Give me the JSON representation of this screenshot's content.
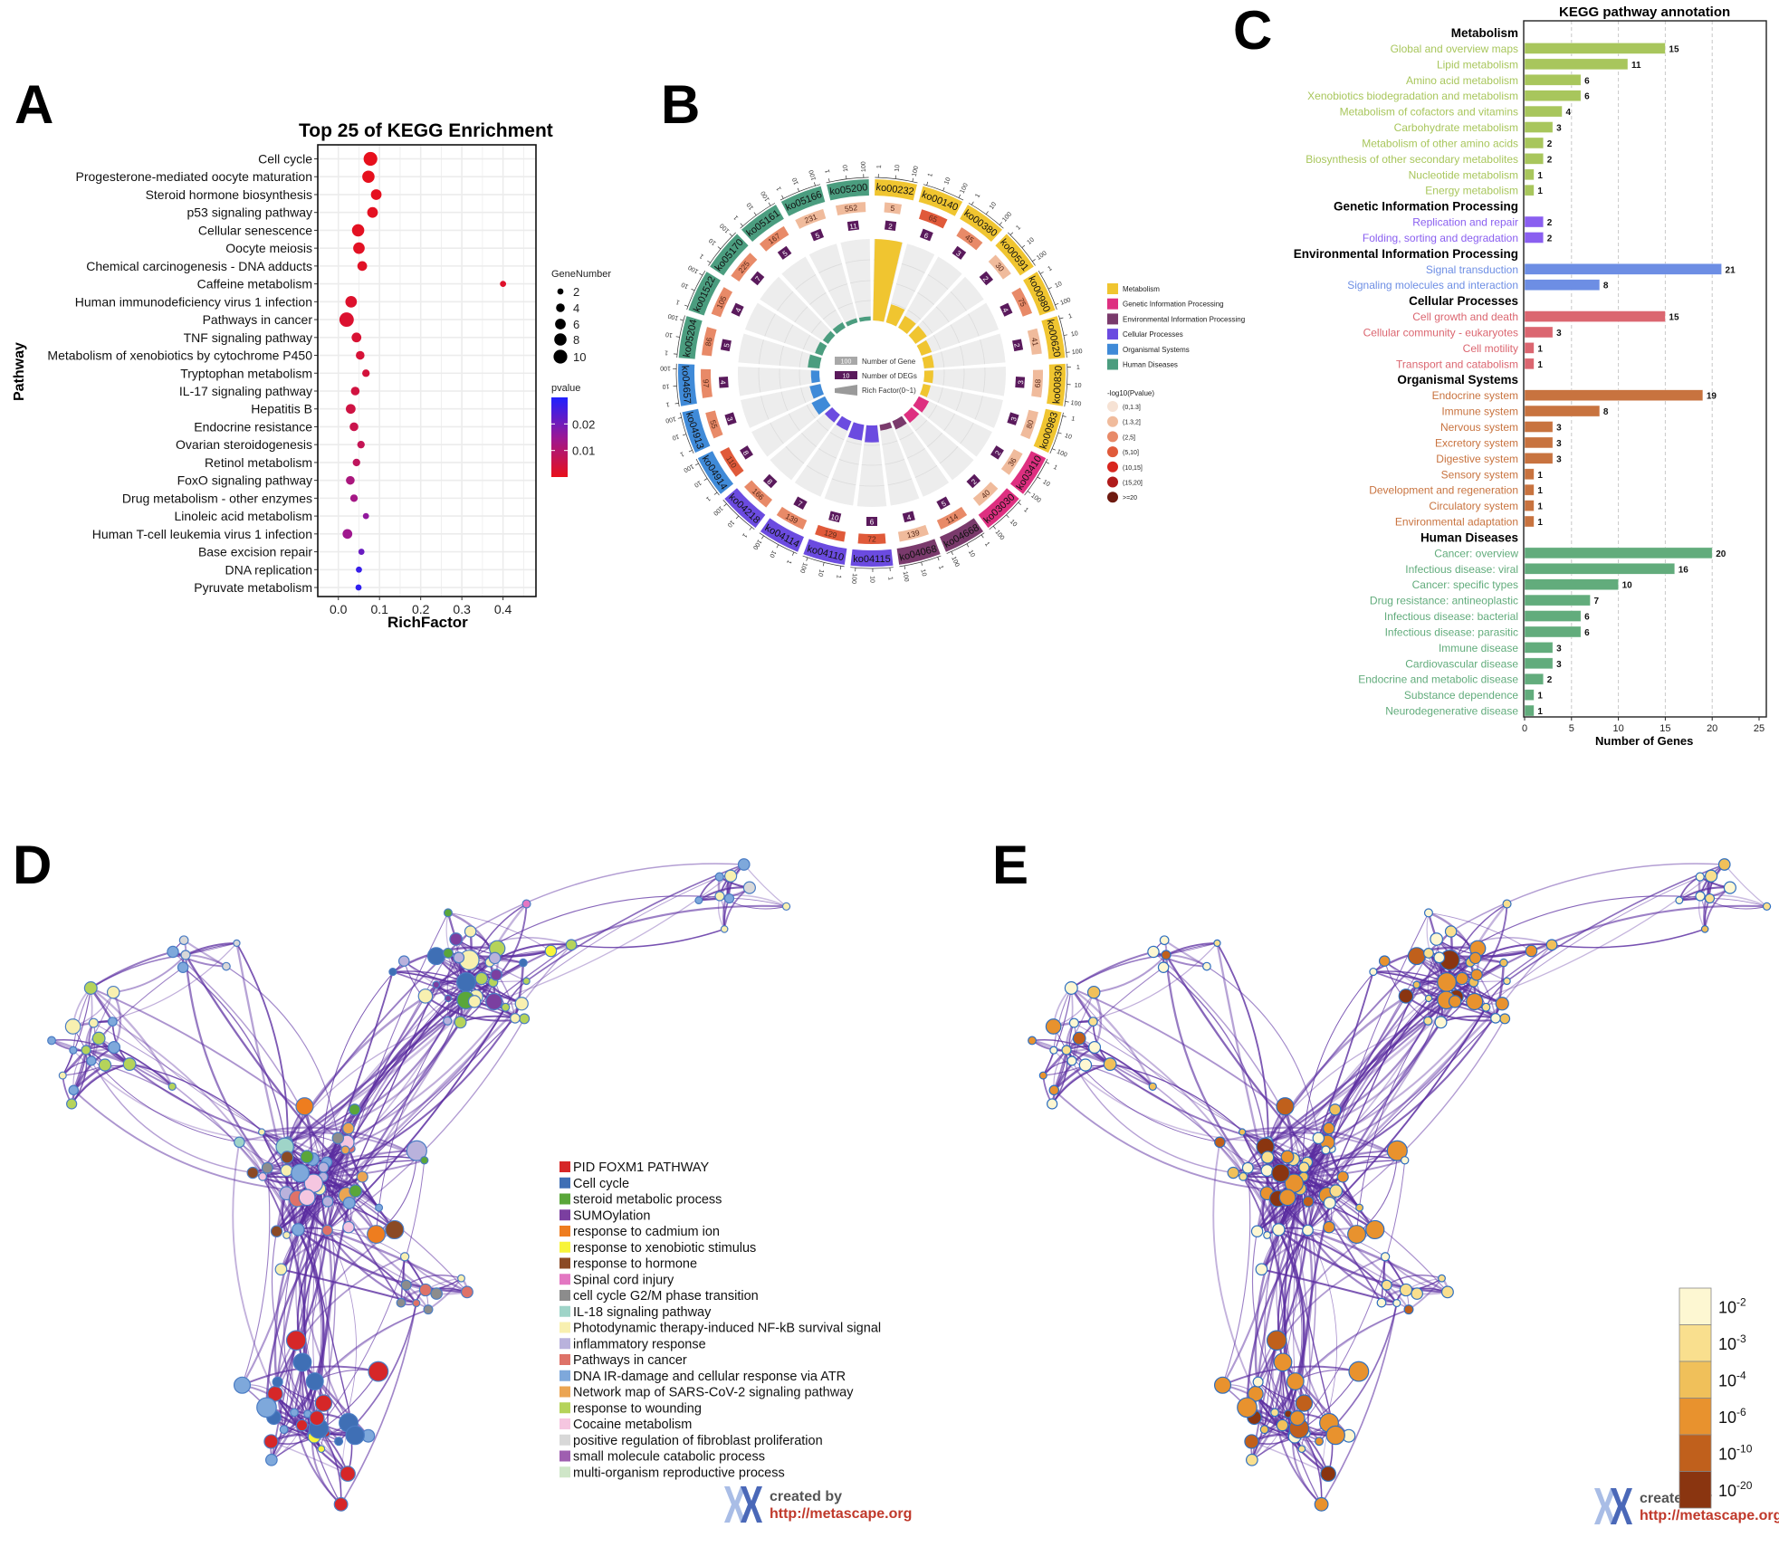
{
  "panel_labels": {
    "a": "A",
    "b": "B",
    "c": "C",
    "d": "D",
    "e": "E"
  },
  "chart_data": [
    {
      "panel": "A",
      "type": "scatter",
      "title": "Top 25 of KEGG Enrichment",
      "xlabel": "RichFactor",
      "ylabel": "Pathway",
      "xlim": [
        -0.05,
        0.48
      ],
      "xticks": [
        0.0,
        0.1,
        0.2,
        0.3,
        0.4
      ],
      "xtick_labels": [
        "0.0",
        "0.1",
        "0.2",
        "0.3",
        "0.4"
      ],
      "grid": true,
      "categories": [
        "Cell cycle",
        "Progesterone-mediated oocyte maturation",
        "Steroid hormone biosynthesis",
        "p53 signaling pathway",
        "Cellular senescence",
        "Oocyte meiosis",
        "Chemical carcinogenesis - DNA adducts",
        "Caffeine metabolism",
        "Human immunodeficiency virus 1 infection",
        "Pathways in cancer",
        "TNF signaling pathway",
        "Metabolism of xenobiotics by cytochrome P450",
        "Tryptophan metabolism",
        "IL-17 signaling pathway",
        "Hepatitis B",
        "Endocrine resistance",
        "Ovarian steroidogenesis",
        "Retinol metabolism",
        "FoxO signaling pathway",
        "Drug metabolism - other enzymes",
        "Linoleic acid metabolism",
        "Human T-cell leukemia virus 1 infection",
        "Base excision repair",
        "DNA replication",
        "Pyruvate metabolism"
      ],
      "x": [
        0.078,
        0.073,
        0.092,
        0.083,
        0.048,
        0.05,
        0.058,
        0.4,
        0.031,
        0.02,
        0.044,
        0.053,
        0.067,
        0.041,
        0.03,
        0.038,
        0.055,
        0.044,
        0.029,
        0.038,
        0.067,
        0.022,
        0.056,
        0.05,
        0.049
      ],
      "gene_number": [
        10,
        8,
        6,
        6,
        8,
        7,
        5,
        2,
        7,
        11,
        5,
        4,
        3,
        4,
        5,
        4,
        3,
        3,
        4,
        3,
        2,
        5,
        2,
        2,
        2
      ],
      "pvalue": [
        0.0002,
        0.0004,
        0.0006,
        0.0008,
        0.001,
        0.0012,
        0.0015,
        0.002,
        0.0022,
        0.0025,
        0.003,
        0.0035,
        0.004,
        0.0045,
        0.005,
        0.006,
        0.007,
        0.008,
        0.012,
        0.013,
        0.016,
        0.014,
        0.021,
        0.027,
        0.028
      ],
      "size_legend": {
        "title": "GeneNumber",
        "values": [
          2,
          4,
          6,
          8,
          10
        ],
        "labels": [
          "2",
          "4",
          "6",
          "8",
          "10"
        ]
      },
      "color_legend": {
        "title": "pvalue",
        "range": [
          0,
          0.03
        ],
        "ticks": [
          0.01,
          0.02
        ],
        "tick_labels": [
          "0.01",
          "0.02"
        ],
        "low_color": "#e8101a",
        "mid_color": "#9a1896",
        "high_color": "#2020ff"
      },
      "legend_placement": "right"
    },
    {
      "panel": "B",
      "type": "circular",
      "categories": [
        {
          "key": "M",
          "name": "Metabolism",
          "color": "#f0c530"
        },
        {
          "key": "G",
          "name": "Genetic Information Processing",
          "color": "#de2f80"
        },
        {
          "key": "E",
          "name": "Environmental Information Processing",
          "color": "#7a3a6c"
        },
        {
          "key": "C",
          "name": "Cellular Processes",
          "color": "#6b4be0"
        },
        {
          "key": "O",
          "name": "Organismal Systems",
          "color": "#3f8ad8"
        },
        {
          "key": "H",
          "name": "Human Diseases",
          "color": "#4b9d7f"
        }
      ],
      "sectors": [
        {
          "id": "ko00232",
          "cat": "M",
          "genes": 5,
          "degs": 2,
          "pbin": 1
        },
        {
          "id": "ko00140",
          "cat": "M",
          "genes": 65,
          "degs": 6,
          "pbin": 3
        },
        {
          "id": "ko00380",
          "cat": "M",
          "genes": 45,
          "degs": 3,
          "pbin": 2
        },
        {
          "id": "ko00591",
          "cat": "M",
          "genes": 30,
          "degs": 2,
          "pbin": 1
        },
        {
          "id": "ko00980",
          "cat": "M",
          "genes": 75,
          "degs": 4,
          "pbin": 2
        },
        {
          "id": "ko00620",
          "cat": "M",
          "genes": 41,
          "degs": 2,
          "pbin": 1
        },
        {
          "id": "ko00830",
          "cat": "M",
          "genes": 68,
          "degs": 3,
          "pbin": 1
        },
        {
          "id": "ko00983",
          "cat": "M",
          "genes": 80,
          "degs": 3,
          "pbin": 1
        },
        {
          "id": "ko03410",
          "cat": "G",
          "genes": 36,
          "degs": 2,
          "pbin": 1
        },
        {
          "id": "ko03030",
          "cat": "G",
          "genes": 40,
          "degs": 2,
          "pbin": 1
        },
        {
          "id": "ko04668",
          "cat": "E",
          "genes": 114,
          "degs": 5,
          "pbin": 2
        },
        {
          "id": "ko04068",
          "cat": "E",
          "genes": 139,
          "degs": 4,
          "pbin": 1
        },
        {
          "id": "ko04115",
          "cat": "C",
          "genes": 72,
          "degs": 6,
          "pbin": 3
        },
        {
          "id": "ko04110",
          "cat": "C",
          "genes": 129,
          "degs": 10,
          "pbin": 3
        },
        {
          "id": "ko04114",
          "cat": "C",
          "genes": 139,
          "degs": 7,
          "pbin": 2
        },
        {
          "id": "ko04218",
          "cat": "C",
          "genes": 166,
          "degs": 8,
          "pbin": 2
        },
        {
          "id": "ko04914",
          "cat": "O",
          "genes": 110,
          "degs": 8,
          "pbin": 3
        },
        {
          "id": "ko04913",
          "cat": "O",
          "genes": 55,
          "degs": 3,
          "pbin": 2
        },
        {
          "id": "ko04657",
          "cat": "O",
          "genes": 97,
          "degs": 4,
          "pbin": 2
        },
        {
          "id": "ko05204",
          "cat": "H",
          "genes": 86,
          "degs": 5,
          "pbin": 2
        },
        {
          "id": "ko01522",
          "cat": "H",
          "genes": 105,
          "degs": 4,
          "pbin": 2
        },
        {
          "id": "ko05170",
          "cat": "H",
          "genes": 225,
          "degs": 7,
          "pbin": 2
        },
        {
          "id": "ko05161",
          "cat": "H",
          "genes": 167,
          "degs": 5,
          "pbin": 2
        },
        {
          "id": "ko05166",
          "cat": "H",
          "genes": 231,
          "degs": 5,
          "pbin": 1
        },
        {
          "id": "ko05200",
          "cat": "H",
          "genes": 552,
          "degs": 11,
          "pbin": 1
        }
      ],
      "scale_tick_labels": [
        "1",
        "10",
        "100"
      ],
      "center_legend": [
        {
          "sample": "100",
          "label": "Number of Gene",
          "color": "#a8a8a8"
        },
        {
          "sample": "10",
          "label": "Number of DEGs",
          "color": "#5a1a5c"
        },
        {
          "sample": "",
          "label": "Rich Factor(0~1)",
          "color": "#9a9a9a"
        }
      ],
      "deg_color": "#5a1a5c",
      "pvalue_legend": {
        "title": "-log10(Pvalue)",
        "bins": [
          {
            "label": "(0,1.3]",
            "color": "#f6e2d4"
          },
          {
            "label": "(1.3,2]",
            "color": "#f0bb9c"
          },
          {
            "label": "(2,5]",
            "color": "#e88a68"
          },
          {
            "label": "(5,10]",
            "color": "#e05a3a"
          },
          {
            "label": "(10,15]",
            "color": "#d8261e"
          },
          {
            "label": "(15,20]",
            "color": "#b01b1b"
          },
          {
            "label": ">=20",
            "color": "#6e1a10"
          }
        ]
      }
    },
    {
      "panel": "C",
      "type": "bar",
      "orientation": "horizontal",
      "title": "KEGG pathway annotation",
      "xlabel": "Number of Genes",
      "xlim": [
        0,
        25
      ],
      "xticks": [
        0,
        5,
        10,
        15,
        20,
        25
      ],
      "grid": "dashed vertical",
      "groups": [
        {
          "name": "Metabolism",
          "color": "#a8c65c",
          "items": [
            {
              "label": "Global and overview maps",
              "value": 15
            },
            {
              "label": "Lipid metabolism",
              "value": 11
            },
            {
              "label": "Amino acid metabolism",
              "value": 6
            },
            {
              "label": "Xenobiotics biodegradation and metabolism",
              "value": 6
            },
            {
              "label": "Metabolism of cofactors and vitamins",
              "value": 4
            },
            {
              "label": "Carbohydrate metabolism",
              "value": 3
            },
            {
              "label": "Metabolism of other amino acids",
              "value": 2
            },
            {
              "label": "Biosynthesis of other secondary metabolites",
              "value": 2
            },
            {
              "label": "Nucleotide metabolism",
              "value": 1
            },
            {
              "label": "Energy metabolism",
              "value": 1
            }
          ]
        },
        {
          "name": "Genetic Information Processing",
          "color": "#8a5ff0",
          "items": [
            {
              "label": "Replication and repair",
              "value": 2
            },
            {
              "label": "Folding, sorting and degradation",
              "value": 2
            }
          ]
        },
        {
          "name": "Environmental Information Processing",
          "color": "#6d8ee4",
          "items": [
            {
              "label": "Signal transduction",
              "value": 21
            },
            {
              "label": "Signaling molecules and interaction",
              "value": 8
            }
          ]
        },
        {
          "name": "Cellular Processes",
          "color": "#db6670",
          "items": [
            {
              "label": "Cell growth and death",
              "value": 15
            },
            {
              "label": "Cellular community - eukaryotes",
              "value": 3
            },
            {
              "label": "Cell motility",
              "value": 1
            },
            {
              "label": "Transport and catabolism",
              "value": 1
            }
          ]
        },
        {
          "name": "Organismal Systems",
          "color": "#c8733f",
          "items": [
            {
              "label": "Endocrine system",
              "value": 19
            },
            {
              "label": "Immune system",
              "value": 8
            },
            {
              "label": "Nervous system",
              "value": 3
            },
            {
              "label": "Excretory system",
              "value": 3
            },
            {
              "label": "Digestive system",
              "value": 3
            },
            {
              "label": "Sensory system",
              "value": 1
            },
            {
              "label": "Development and regeneration",
              "value": 1
            },
            {
              "label": "Circulatory system",
              "value": 1
            },
            {
              "label": "Environmental adaptation",
              "value": 1
            }
          ]
        },
        {
          "name": "Human Diseases",
          "color": "#62ac7c",
          "items": [
            {
              "label": "Cancer: overview",
              "value": 20
            },
            {
              "label": "Infectious disease: viral",
              "value": 16
            },
            {
              "label": "Cancer: specific types",
              "value": 10
            },
            {
              "label": "Drug resistance: antineoplastic",
              "value": 7
            },
            {
              "label": "Infectious disease: bacterial",
              "value": 6
            },
            {
              "label": "Infectious disease: parasitic",
              "value": 6
            },
            {
              "label": "Immune disease",
              "value": 3
            },
            {
              "label": "Cardiovascular disease",
              "value": 3
            },
            {
              "label": "Endocrine and metabolic disease",
              "value": 2
            },
            {
              "label": "Substance dependence",
              "value": 1
            },
            {
              "label": "Neurodegenerative disease",
              "value": 1
            }
          ]
        }
      ]
    }
  ],
  "network_d": {
    "edge_color": "#5a2ca0",
    "node_stroke": "#4a7cc4",
    "legend": [
      {
        "label": "PID FOXM1 PATHWAY",
        "color": "#d62728"
      },
      {
        "label": "Cell cycle",
        "color": "#3f6fb5"
      },
      {
        "label": "steroid metabolic process",
        "color": "#5aa63a"
      },
      {
        "label": "SUMOylation",
        "color": "#7b3fa0"
      },
      {
        "label": "response to cadmium ion",
        "color": "#ee7d1f"
      },
      {
        "label": "response to xenobiotic stimulus",
        "color": "#f7f43a"
      },
      {
        "label": "response to hormone",
        "color": "#8b4a25"
      },
      {
        "label": "Spinal cord injury",
        "color": "#e377c2"
      },
      {
        "label": "cell cycle G2/M phase transition",
        "color": "#8c8c8c"
      },
      {
        "label": "IL-18 signaling pathway",
        "color": "#9fd4c8"
      },
      {
        "label": "Photodynamic therapy-induced NF-kB survival signal",
        "color": "#f8f0b0"
      },
      {
        "label": "inflammatory response",
        "color": "#b9b2dc"
      },
      {
        "label": "Pathways in cancer",
        "color": "#de7268"
      },
      {
        "label": "DNA IR-damage and cellular response via ATR",
        "color": "#7ea8db"
      },
      {
        "label": "Network map of SARS-CoV-2 signaling pathway",
        "color": "#eba553"
      },
      {
        "label": "response to wounding",
        "color": "#b5d35a"
      },
      {
        "label": "Cocaine metabolism",
        "color": "#f5c6e0"
      },
      {
        "label": "positive regulation of fibroblast proliferation",
        "color": "#d8d8d8"
      },
      {
        "label": "small molecule catabolic process",
        "color": "#9f5fb0"
      },
      {
        "label": "multi-organism reproductive process",
        "color": "#cfe6c8"
      }
    ],
    "credit": {
      "created_by": "created by",
      "url": "http://metascape.org"
    }
  },
  "network_e": {
    "edge_color": "#5a2ca0",
    "node_stroke": "#2f6fc0",
    "colorbar": [
      {
        "base": "10",
        "exp": "-2",
        "color": "#fdf7d2"
      },
      {
        "base": "10",
        "exp": "-3",
        "color": "#f9df8e"
      },
      {
        "base": "10",
        "exp": "-4",
        "color": "#f0c05a"
      },
      {
        "base": "10",
        "exp": "-6",
        "color": "#e8922e"
      },
      {
        "base": "10",
        "exp": "-10",
        "color": "#c0601c"
      },
      {
        "base": "10",
        "exp": "-20",
        "color": "#8a3510"
      }
    ],
    "credit": {
      "created_by": "created by",
      "url": "http://metascape.org"
    }
  }
}
